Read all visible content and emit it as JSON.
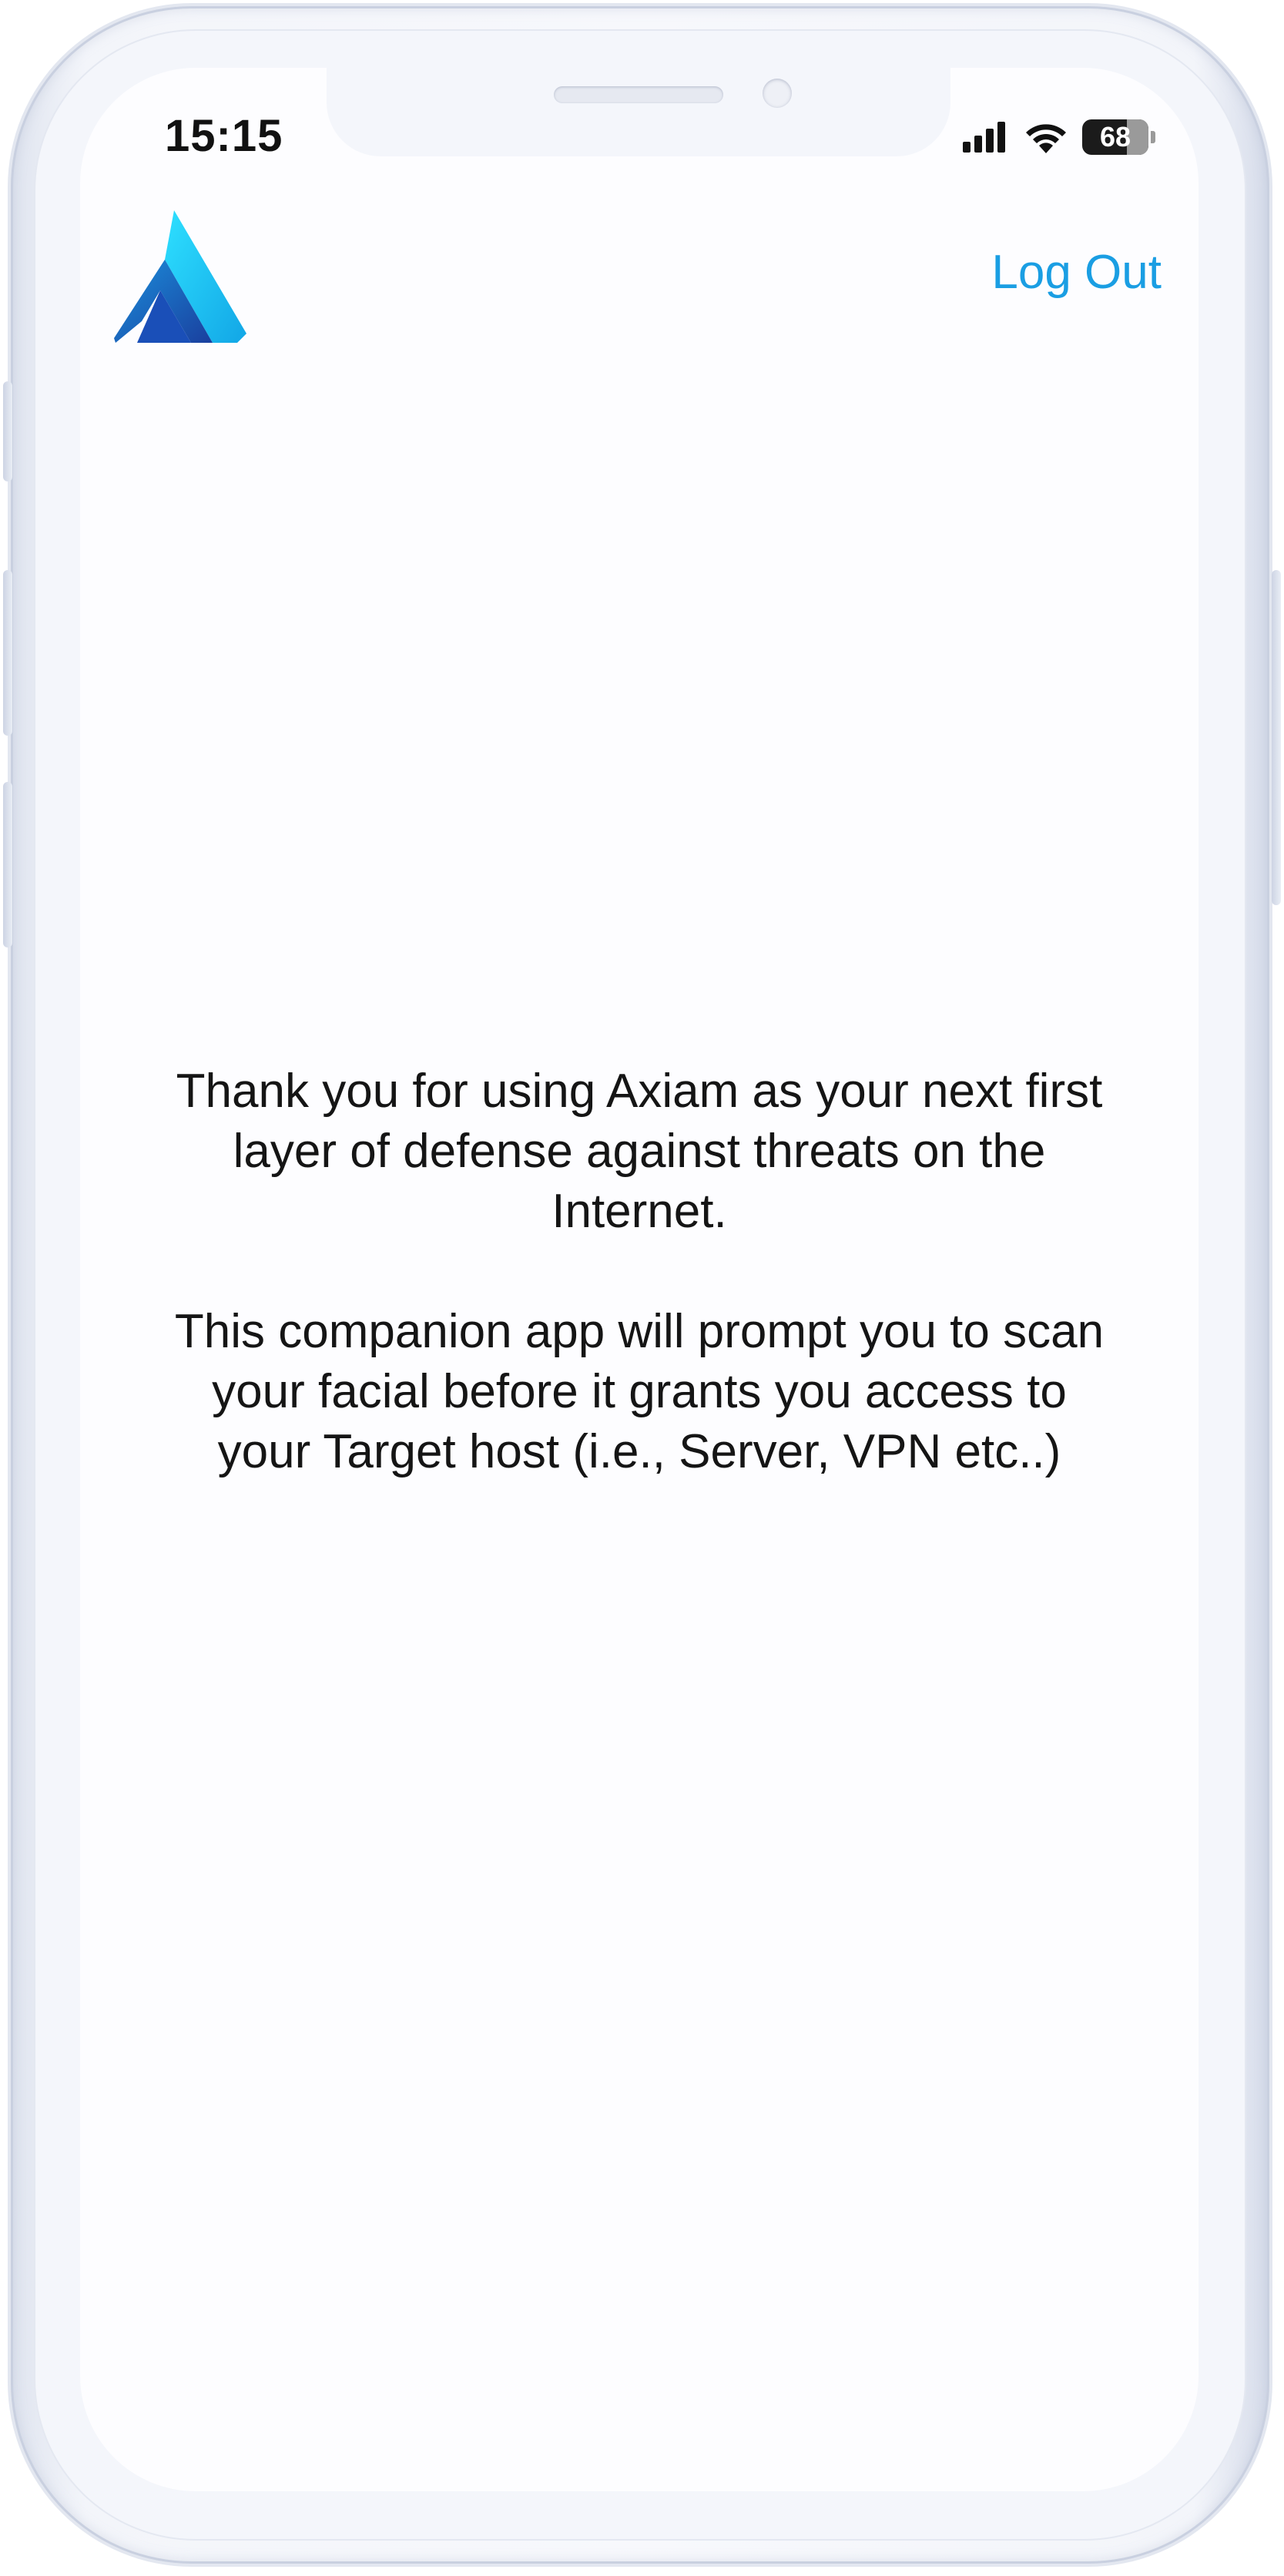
{
  "status_bar": {
    "time": "15:15",
    "battery_level": "68",
    "battery_percent": 68,
    "icons": [
      "cellular-signal-icon",
      "wifi-icon",
      "battery-icon"
    ]
  },
  "header": {
    "logo": "axiam-logo",
    "logout_label": "Log Out"
  },
  "content": {
    "paragraph_1": "Thank you for using Axiam as your next first layer of defense against threats on the Internet.",
    "paragraph_2": "This companion app will prompt you to scan your facial before it grants you access to your Target host (i.e., Server, VPN etc..)"
  },
  "colors": {
    "accent": "#1a9ee3",
    "text": "#151515",
    "logo_light": "#1ec8f2",
    "logo_dark": "#1a3f9e"
  }
}
